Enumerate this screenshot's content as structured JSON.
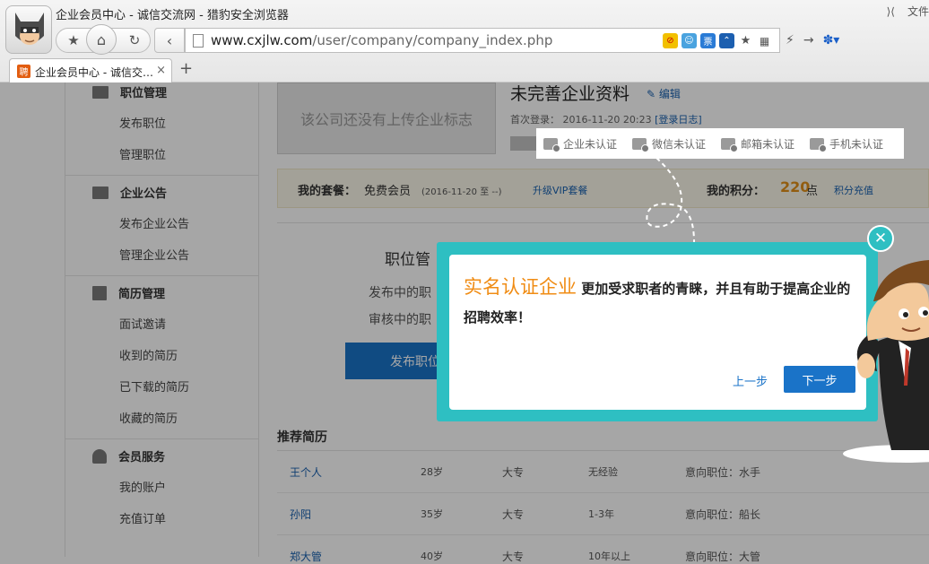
{
  "browser": {
    "window_title": "企业会员中心 - 诚信交流网 - 猎豹安全浏览器",
    "window_right": "文件",
    "url_host": "www.cxjlw.com",
    "url_path": "/user/company/company_index.php",
    "tab_favicon": "聘",
    "tab_label": "企业会员中心 - 诚信交…",
    "tab_close": "×",
    "new_tab": "+",
    "ext_ticket": "票"
  },
  "sidebar": {
    "sections": [
      {
        "title": "职位管理",
        "icon": "folder-icon",
        "items": [
          "发布职位",
          "管理职位"
        ]
      },
      {
        "title": "企业公告",
        "icon": "folder-icon",
        "items": [
          "发布企业公告",
          "管理企业公告"
        ]
      },
      {
        "title": "简历管理",
        "icon": "resume-icon",
        "items": [
          "面试邀请",
          "收到的简历",
          "已下载的简历",
          "收藏的简历"
        ]
      },
      {
        "title": "会员服务",
        "icon": "user-icon",
        "items": [
          "我的账户",
          "充值订单"
        ]
      }
    ]
  },
  "company": {
    "logo_placeholder": "该公司还没有上传企业标志",
    "name": "未完善企业资料",
    "edit": "编辑",
    "first_login_label": "首次登录：",
    "first_login_time": "2016-11-20 20:23",
    "login_log": "[登录日志]"
  },
  "package": {
    "label": "我的套餐：",
    "value": "免费会员",
    "date": "(2016-11-20 至 --)",
    "upgrade": "升级VIP套餐",
    "points_label": "我的积分：",
    "points_value": "220",
    "points_unit": "点",
    "charge": "积分充值"
  },
  "jobs": {
    "title": "职位管",
    "line1": "发布中的职",
    "line2": "审核中的职",
    "publish_button": "发布职位"
  },
  "recommended": {
    "title": "推荐简历",
    "rows": [
      {
        "name": "王个人",
        "age": "28岁",
        "edu": "大专",
        "exp": "无经验",
        "intent": "意向职位：水手"
      },
      {
        "name": "孙阳",
        "age": "35岁",
        "edu": "大专",
        "exp": "1-3年",
        "intent": "意向职位：船长"
      },
      {
        "name": "郑大管",
        "age": "40岁",
        "edu": "大专",
        "exp": "10年以上",
        "intent": "意向职位：大管"
      }
    ]
  },
  "certifications": [
    "企业未认证",
    "微信未认证",
    "邮箱未认证",
    "手机未认证"
  ],
  "guide": {
    "highlight": "实名认证企业",
    "text": "更加受求职者的青睐，并且有助于提高企业的招聘效率！",
    "prev": "上一步",
    "next": "下一步",
    "close": "✕"
  },
  "colors": {
    "accent": "#1a73c8",
    "teal": "#2ebfc2",
    "orange": "#f08c14"
  }
}
